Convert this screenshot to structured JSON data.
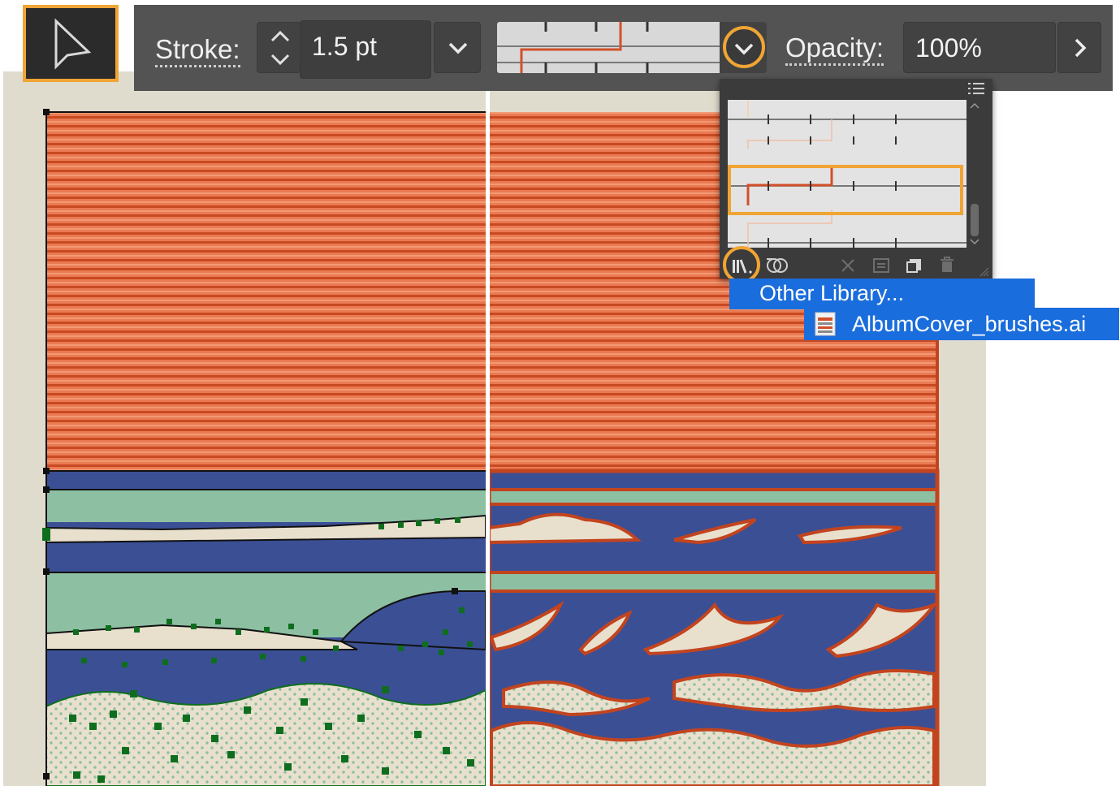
{
  "toolbar": {
    "selection_tool": "selection-arrow-icon",
    "stroke_label": "Stroke:",
    "stroke_value": "1.5 pt",
    "opacity_label": "Opacity:",
    "opacity_value": "100%"
  },
  "brush_library_menu": {
    "item": "Other Library...",
    "submenu_item": "AlbumCover_brushes.ai"
  },
  "colors": {
    "accent_highlight": "#f0a534",
    "toolbar_bg": "#535353",
    "menu_selection": "#1a6ddc",
    "sky_orange": "#e6714d",
    "stripe_dark": "#c2441f",
    "sea_blue": "#3b4f95",
    "sea_green": "#8dbfa2",
    "foam_cream": "#e8e0cd",
    "anchor_green": "#0e6e1e"
  }
}
